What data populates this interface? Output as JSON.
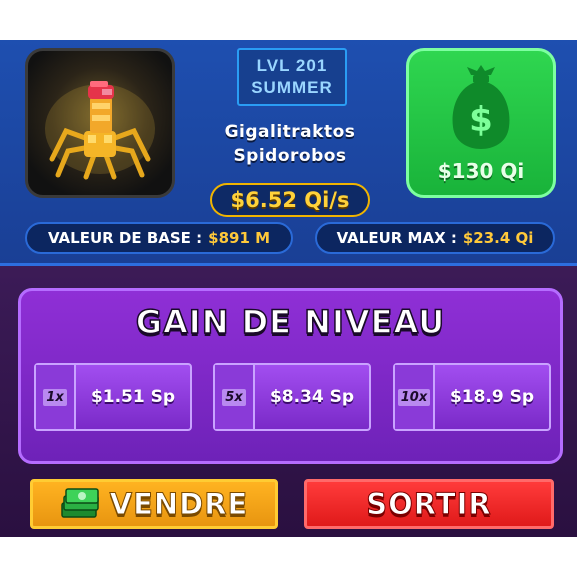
{
  "pet": {
    "level": "LVL 201",
    "variant": "SUMMER",
    "name_line1": "Gigalitraktos",
    "name_line2": "Spidorobos",
    "rate": "$6.52 Qi/s",
    "cash_value": "$130 Qi",
    "icon": "pet-portrait-spider-robot",
    "cash_icon": "money-bag-icon"
  },
  "stats": {
    "base_label": "VALEUR DE BASE :",
    "base_value": "$891 M",
    "max_label": "VALEUR MAX :",
    "max_value": "$23.4 Qi"
  },
  "upgrade": {
    "title": "GAIN DE NIVEAU",
    "options": [
      {
        "multiplier": "1x",
        "price": "$1.51 Sp"
      },
      {
        "multiplier": "5x",
        "price": "$8.34 Sp"
      },
      {
        "multiplier": "10x",
        "price": "$18.9 Sp"
      }
    ]
  },
  "actions": {
    "sell_label": "VENDRE",
    "sell_icon": "cash-stack-icon",
    "exit_label": "SORTIR"
  },
  "colors": {
    "info_bg": "#1e4fb0",
    "gold": "#ffd23a",
    "green": "#2fd650",
    "purple": "#8f2fd6",
    "sell": "#ffb321",
    "exit": "#ff3b3b"
  }
}
